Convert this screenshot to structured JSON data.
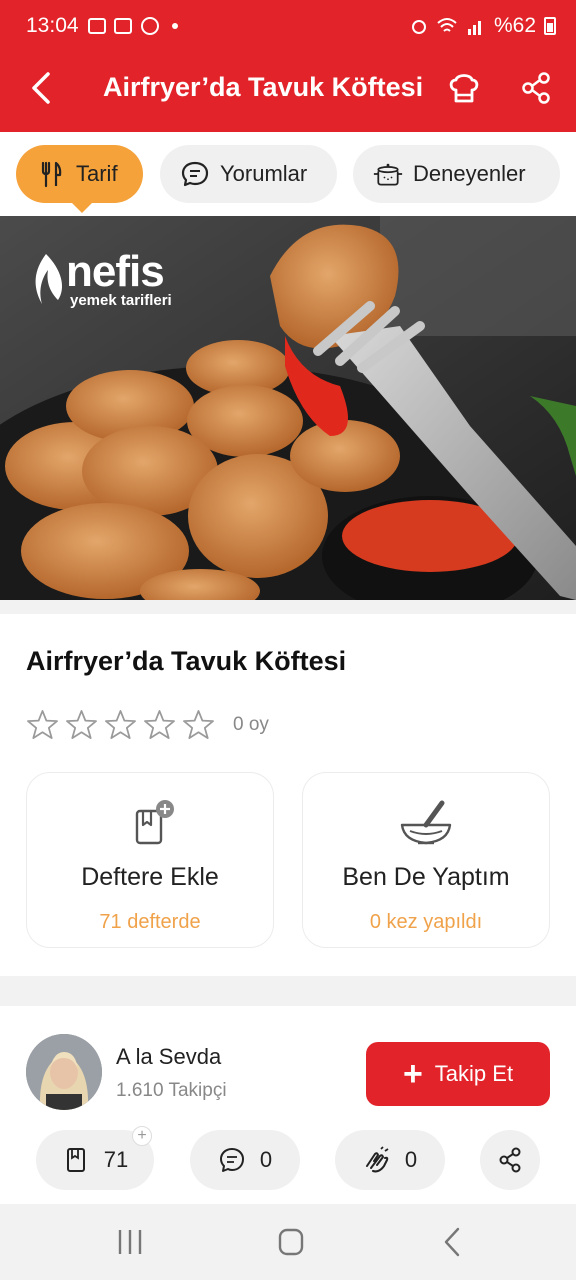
{
  "status_bar": {
    "time": "13:04",
    "battery": "%62"
  },
  "header": {
    "title": "Airfryer’da Tavuk Köftesi"
  },
  "tabs": [
    {
      "label": "Tarif",
      "icon": "cutlery-icon",
      "active": true
    },
    {
      "label": "Yorumlar",
      "icon": "comment-icon",
      "active": false
    },
    {
      "label": "Deneyenler",
      "icon": "pot-icon",
      "active": false
    }
  ],
  "hero": {
    "logo_word": "nefis",
    "logo_sub": "yemek tarifleri"
  },
  "recipe": {
    "title": "Airfryer’da Tavuk Köftesi",
    "rating": 0,
    "rating_count": "0 oy"
  },
  "actions": [
    {
      "label": "Deftere Ekle",
      "sub": "71 defterde",
      "icon": "notebook-add-icon"
    },
    {
      "label": "Ben De Yaptım",
      "sub": "0 kez yapıldı",
      "icon": "mortar-icon"
    }
  ],
  "author": {
    "name": "A la Sevda",
    "followers": "1.610 Takipçi",
    "follow_label": "Takip Et"
  },
  "bottom_actions": {
    "saves": "71",
    "comments": "0",
    "tried": "0"
  },
  "colors": {
    "brand_red": "#e2232a",
    "accent_orange": "#f6a23a",
    "sub_orange": "#f0a24a"
  }
}
